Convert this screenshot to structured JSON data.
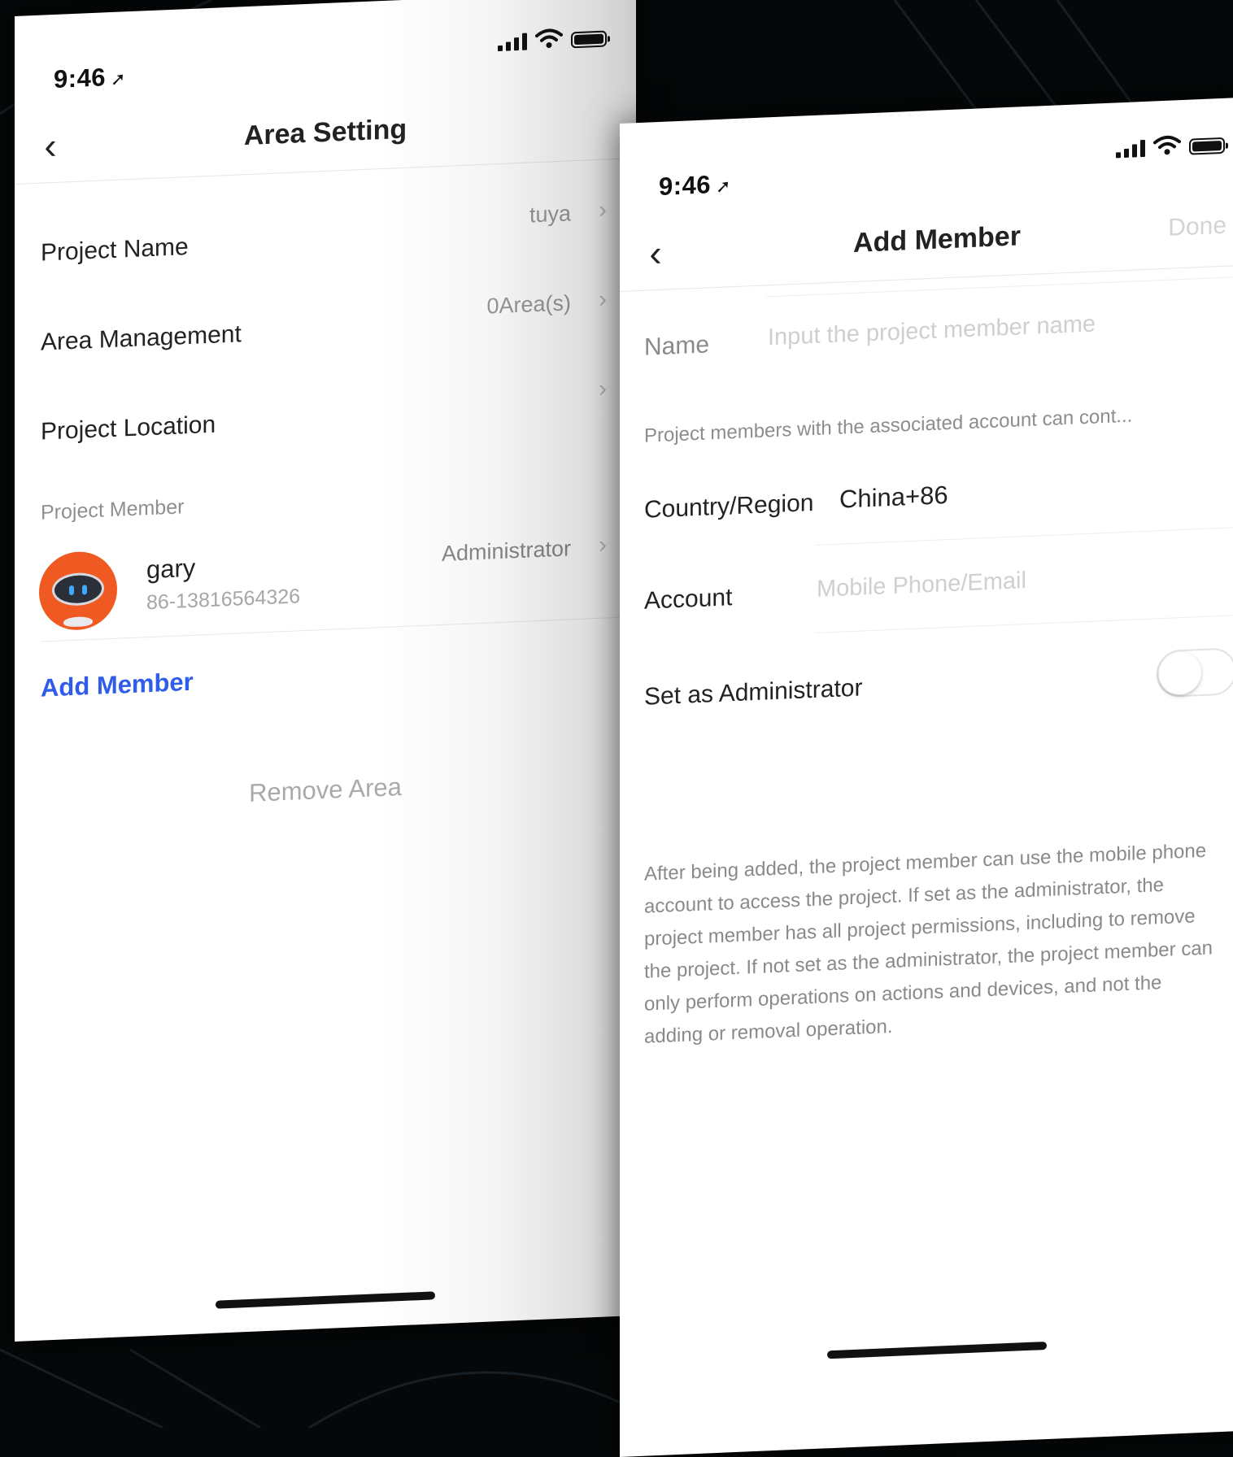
{
  "status_bar": {
    "time": "9:46",
    "location_arrow": "location-arrow-icon"
  },
  "left_screen": {
    "back_icon": "chevron-left-icon",
    "title": "Area Setting",
    "rows": [
      {
        "label": "Project Name",
        "value": "tuya"
      },
      {
        "label": "Area Management",
        "value": "0Area(s)"
      },
      {
        "label": "Project Location",
        "value": ""
      }
    ],
    "section_label": "Project Member",
    "member": {
      "name": "gary",
      "phone": "86-13816564326",
      "role": "Administrator"
    },
    "add_member_label": "Add Member",
    "remove_area_label": "Remove Area"
  },
  "right_screen": {
    "back_icon": "chevron-left-icon",
    "title": "Add Member",
    "done_label": "Done",
    "name_label": "Name",
    "name_placeholder": "Input the project member name",
    "associated_hint": "Project members with the associated account can cont...",
    "region_label": "Country/Region",
    "region_value": "China+86",
    "account_label": "Account",
    "account_placeholder": "Mobile Phone/Email",
    "admin_label": "Set as Administrator",
    "admin_enabled": false,
    "admin_description": "After being added, the project member can use the mobile phone account to access the project. If set as the administrator, the project member has all project permissions, including to remove the project. If not set as the administrator, the project member can only perform operations on actions and devices, and not the adding or removal operation."
  },
  "colors": {
    "accent": "#2f5ce8",
    "background": "#050708",
    "avatar": "#f05a22"
  }
}
